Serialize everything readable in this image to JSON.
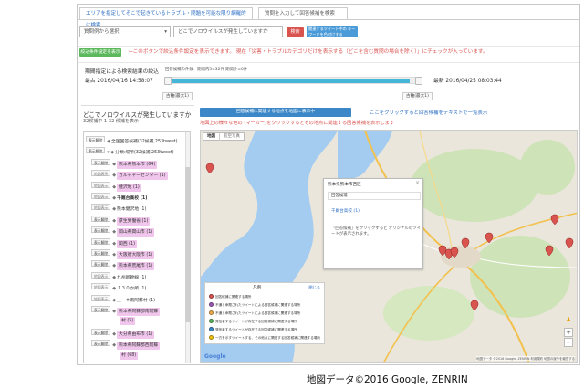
{
  "tabs": [
    {
      "label": "エリアを指定してそこで起きているトラブル・問題を可能な限り網羅的に検索"
    },
    {
      "label": "質問を入力して回答候補を検索"
    }
  ],
  "question": {
    "select_value": "質問例から選択",
    "caret": "▾",
    "input_value": "どこでノロウイルスが発生していますか",
    "search_label": "検索",
    "extra_label": "関連するツイート中の キーワードを色付けする"
  },
  "filter": {
    "button_label": "絞込条件設定を表示",
    "note": "←このボタンで絞込条件設定を表示できます。 現在「災害・トラブルカテゴリだけを表示する（どこを含む質問の場合を除く）」にチェックが入っています。"
  },
  "period": {
    "title": "期間指定による検索結果の絞込",
    "count_text": "回答候補の件数：期間内5=32件 期間外=0件",
    "start_label": "最古 2016/04/16 14:58:07",
    "end_label": "最新 2016/04/25 08:03:44",
    "range_fraction": 0.97,
    "left_btn": "古軸(最大1)",
    "right_btn": "古軸(最大1)"
  },
  "left": {
    "question": "どこでノロウイルスが発生していますか",
    "sub": "32候補中 1-32 候補を表示",
    "tree": [
      {
        "chip": "表示解除",
        "icon": "◆",
        "text": "全国回答候補(32候補,253tweet)",
        "style": "plain",
        "indent": 0
      },
      {
        "chip": "",
        "icon": "▾ ◆",
        "text": "分類:場所(32候補,253tweet)",
        "style": "plain",
        "indent": 0,
        "chip2": "表示解除"
      },
      {
        "chip": "表示解除",
        "icon": "◆",
        "text": "熊本県熊本市 (64)",
        "style": "pink",
        "indent": 1
      },
      {
        "chip": "地図表示",
        "icon": "◆",
        "text": "カルチャーセンター (1)",
        "style": "pink",
        "indent": 1
      },
      {
        "chip": "地図表示",
        "icon": "◆",
        "text": "健沢地 (1)",
        "style": "pink",
        "indent": 1
      },
      {
        "chip": "地図表示",
        "icon": "◆",
        "text": "千厩台高校 (1)",
        "style": "bold",
        "indent": 1
      },
      {
        "chip": "地図表示",
        "icon": "◆",
        "text": "熊本健沢地 (1)",
        "style": "plain",
        "indent": 1
      },
      {
        "chip": "表示解除",
        "icon": "◆",
        "text": "厚生労働省 (1)",
        "style": "pink",
        "indent": 1
      },
      {
        "chip": "表示解除",
        "icon": "◆",
        "text": "岡山県岡山市 (1)",
        "style": "pink",
        "indent": 1
      },
      {
        "chip": "表示解除",
        "icon": "◆",
        "text": "関西 (1)",
        "style": "pink",
        "indent": 1
      },
      {
        "chip": "表示解除",
        "icon": "◆",
        "text": "大阪府大阪市 (1)",
        "style": "pink",
        "indent": 1
      },
      {
        "chip": "表示解除",
        "icon": "◆",
        "text": "熊本県荒尾市 (1)",
        "style": "pink",
        "indent": 1
      },
      {
        "chip": "地図表示",
        "icon": "◆",
        "text": "九州新幹線 (1)",
        "style": "plain",
        "indent": 1
      },
      {
        "chip": "地図表示",
        "icon": "◆",
        "text": "１３０か所 (1)",
        "style": "plain",
        "indent": 1
      },
      {
        "chip": "地図表示",
        "icon": "◆",
        "text": "＿ー＃南阿蘇村 (1)",
        "style": "plain",
        "indent": 1
      },
      {
        "chip": "表示解除",
        "icon": "◆",
        "text": "熊本県阿蘇郡南阿蘇",
        "style": "pink",
        "indent": 1
      },
      {
        "chip": "",
        "icon": "",
        "text": "村 (5)",
        "style": "pink",
        "indent": 1
      },
      {
        "chip": "表示解除",
        "icon": "◆",
        "text": "大分県由布市 (1)",
        "style": "pink",
        "indent": 1
      },
      {
        "chip": "表示解除",
        "icon": "◆",
        "text": "熊本県阿蘇郡西阿蘇",
        "style": "pink",
        "indent": 1
      },
      {
        "chip": "",
        "icon": "",
        "text": "村 (68)",
        "style": "pink",
        "indent": 1
      }
    ]
  },
  "right": {
    "map_button": "回答候補に関連する地点を地図に表示中",
    "text_link": "ここをクリックすると回答候補をテキストで一覧表示",
    "note": "地図上の様々な色の  (マーカー)をクリックするとその地点に関連する回答候補を表示します",
    "map_type_map": "地図",
    "map_type_sat": "航空写真",
    "popup": {
      "header": "熊本県熊本市西区",
      "close": "×",
      "tag": "回答候補",
      "link": "千厩台高校 (1)",
      "msg": "「回答候補」をクリックすると オリジナルのツイートが表示されます。"
    },
    "legend": {
      "title": "凡例",
      "close": "閉じる",
      "items": [
        {
          "color": "#d9534f",
          "text": "回答候補に関連する場所"
        },
        {
          "color": "#9b59b6",
          "text": "不通と命題されたツイートによる回答候補に関連する場所"
        },
        {
          "color": "#f0ad4e",
          "text": "不通と命題されたツイートによる回答候補に関連する場所"
        },
        {
          "color": "#5cb85c",
          "text": "発信者するツイートが存在する回答候補に関連する場所"
        },
        {
          "color": "#3c87c7",
          "text": "発信者するツイートが存在する回答候補に関連する場所"
        },
        {
          "color": "#f1c40f",
          "text": "一方を示すツイートする、その他点に関連する回答候補に関連する場所"
        }
      ]
    },
    "google": "Google",
    "copyright": "地図データ ©2016 Google, ZENRIN  利用規約  地図の誤りを報告する"
  },
  "caption": "地図データ©2016 Google, ZENRIN"
}
